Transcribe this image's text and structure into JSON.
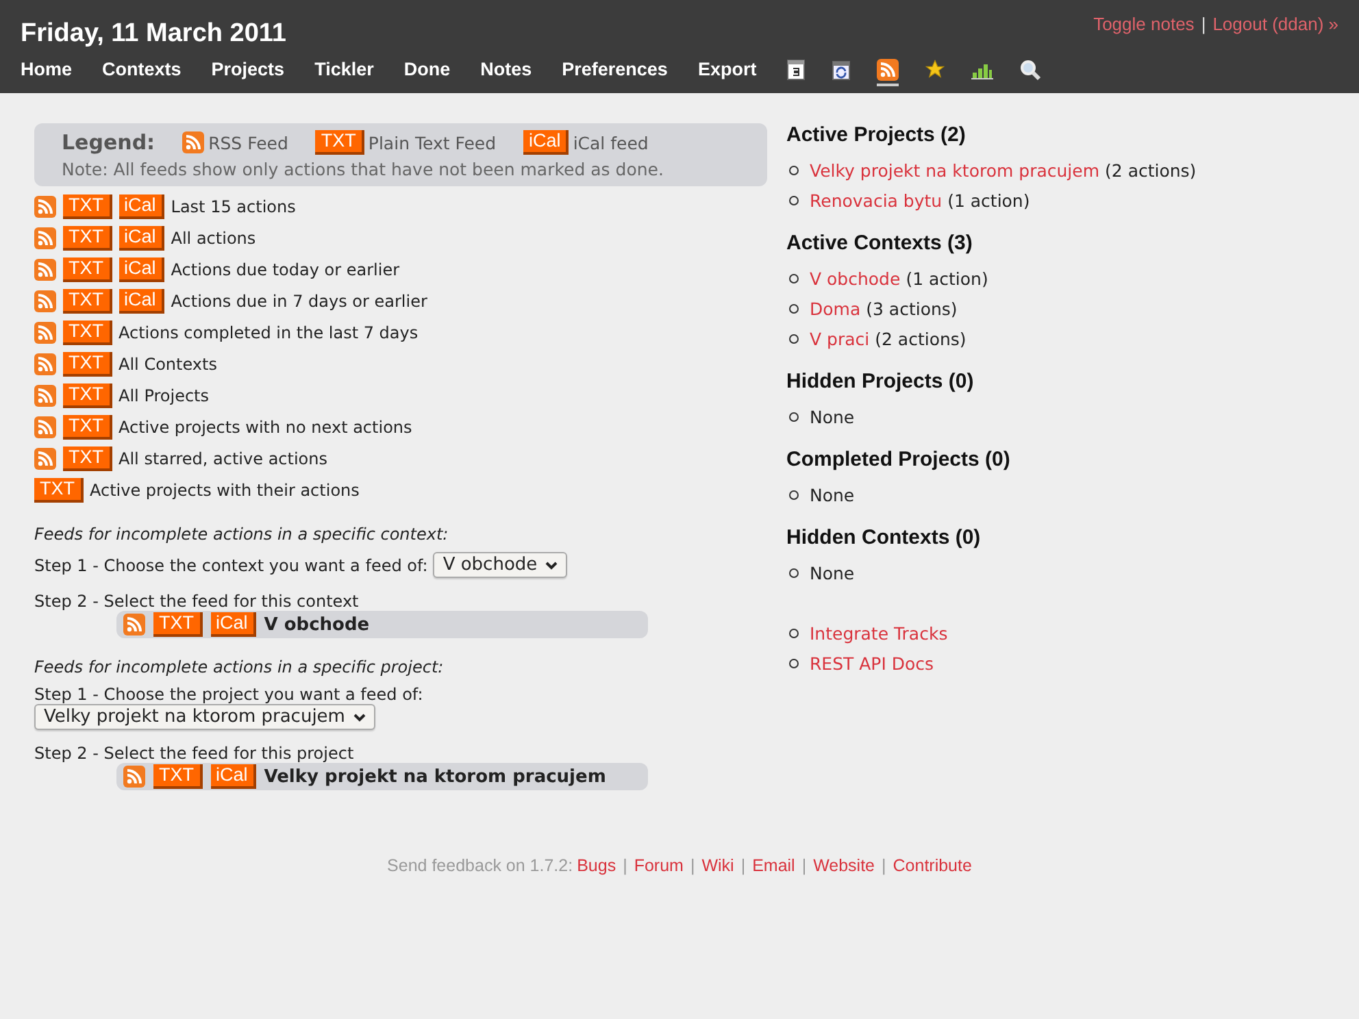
{
  "header": {
    "date": "Friday, 11 March 2011",
    "links": [
      {
        "label": "Toggle notes"
      },
      {
        "label": "Logout (ddan) »"
      }
    ],
    "separator": "|"
  },
  "nav": [
    {
      "kind": "text",
      "label": "Home",
      "selected": false
    },
    {
      "kind": "text",
      "label": "Contexts",
      "selected": false
    },
    {
      "kind": "text",
      "label": "Projects",
      "selected": false
    },
    {
      "kind": "text",
      "label": "Tickler",
      "selected": false
    },
    {
      "kind": "text",
      "label": "Done",
      "selected": false
    },
    {
      "kind": "text",
      "label": "Notes",
      "selected": false
    },
    {
      "kind": "text",
      "label": "Preferences",
      "selected": false
    },
    {
      "kind": "text",
      "label": "Export",
      "selected": false
    },
    {
      "kind": "calendar",
      "selected": false
    },
    {
      "kind": "recurring",
      "selected": false
    },
    {
      "kind": "feed",
      "selected": true
    },
    {
      "kind": "star",
      "selected": false
    },
    {
      "kind": "stats",
      "selected": false
    },
    {
      "kind": "search",
      "selected": false
    }
  ],
  "legend": {
    "title": "Legend:",
    "items": [
      {
        "kind": "rss",
        "label": "RSS Feed"
      },
      {
        "kind": "badge",
        "badge": "TXT",
        "label": "Plain Text Feed"
      },
      {
        "kind": "badge",
        "badge": "iCal",
        "label": "iCal feed"
      }
    ],
    "note": "Note: All feeds show only actions that have not been marked as done."
  },
  "feeds": [
    {
      "rss": true,
      "badges": [
        "TXT",
        "iCal"
      ],
      "label": "Last 15 actions"
    },
    {
      "rss": true,
      "badges": [
        "TXT",
        "iCal"
      ],
      "label": "All actions"
    },
    {
      "rss": true,
      "badges": [
        "TXT",
        "iCal"
      ],
      "label": "Actions due today or earlier"
    },
    {
      "rss": true,
      "badges": [
        "TXT",
        "iCal"
      ],
      "label": "Actions due in 7 days or earlier"
    },
    {
      "rss": true,
      "badges": [
        "TXT"
      ],
      "label": "Actions completed in the last 7 days"
    },
    {
      "rss": true,
      "badges": [
        "TXT"
      ],
      "label": "All Contexts"
    },
    {
      "rss": true,
      "badges": [
        "TXT"
      ],
      "label": "All Projects"
    },
    {
      "rss": true,
      "badges": [
        "TXT"
      ],
      "label": "Active projects with no next actions"
    },
    {
      "rss": true,
      "badges": [
        "TXT"
      ],
      "label": "All starred, active actions"
    },
    {
      "rss": false,
      "badges": [
        "TXT"
      ],
      "label": "Active projects with their actions"
    }
  ],
  "specific": [
    {
      "heading": "Feeds for incomplete actions in a specific context:",
      "step1": "Step 1 - Choose the context you want a feed of:",
      "inline": true,
      "dropdown": "V obchode",
      "step2": "Step 2 - Select the feed for this context",
      "feed": {
        "rss": true,
        "badges": [
          "TXT",
          "iCal"
        ],
        "label": "V obchode"
      }
    },
    {
      "heading": "Feeds for incomplete actions in a specific project:",
      "step1": "Step 1 - Choose the project you want a feed of:",
      "inline": false,
      "dropdown": "Velky projekt na ktorom pracujem",
      "step2": "Step 2 - Select the feed for this project",
      "feed": {
        "rss": true,
        "badges": [
          "TXT",
          "iCal"
        ],
        "label": "Velky projekt na ktorom pracujem"
      }
    }
  ],
  "sidebar": [
    {
      "heading": "Active Projects (2)",
      "items": [
        {
          "link": "Velky projekt na ktorom pracujem",
          "note": "(2 actions)"
        },
        {
          "link": "Renovacia bytu",
          "note": "(1 action)"
        }
      ]
    },
    {
      "heading": "Active Contexts (3)",
      "items": [
        {
          "link": "V obchode",
          "note": "(1 action)"
        },
        {
          "link": "Doma",
          "note": "(3 actions)"
        },
        {
          "link": "V praci",
          "note": "(2 actions)"
        }
      ]
    },
    {
      "heading": "Hidden Projects (0)",
      "items": [
        {
          "text": "None"
        }
      ]
    },
    {
      "heading": "Completed Projects (0)",
      "items": [
        {
          "text": "None"
        }
      ]
    },
    {
      "heading": "Hidden Contexts (0)",
      "items": [
        {
          "text": "None"
        }
      ]
    }
  ],
  "sidebar_links": [
    {
      "link": "Integrate Tracks"
    },
    {
      "link": "REST API Docs"
    }
  ],
  "footer": {
    "text": "Send feedback on 1.7.2:",
    "separator": "|",
    "links": [
      "Bugs",
      "Forum",
      "Wiki",
      "Email",
      "Website",
      "Contribute"
    ]
  }
}
